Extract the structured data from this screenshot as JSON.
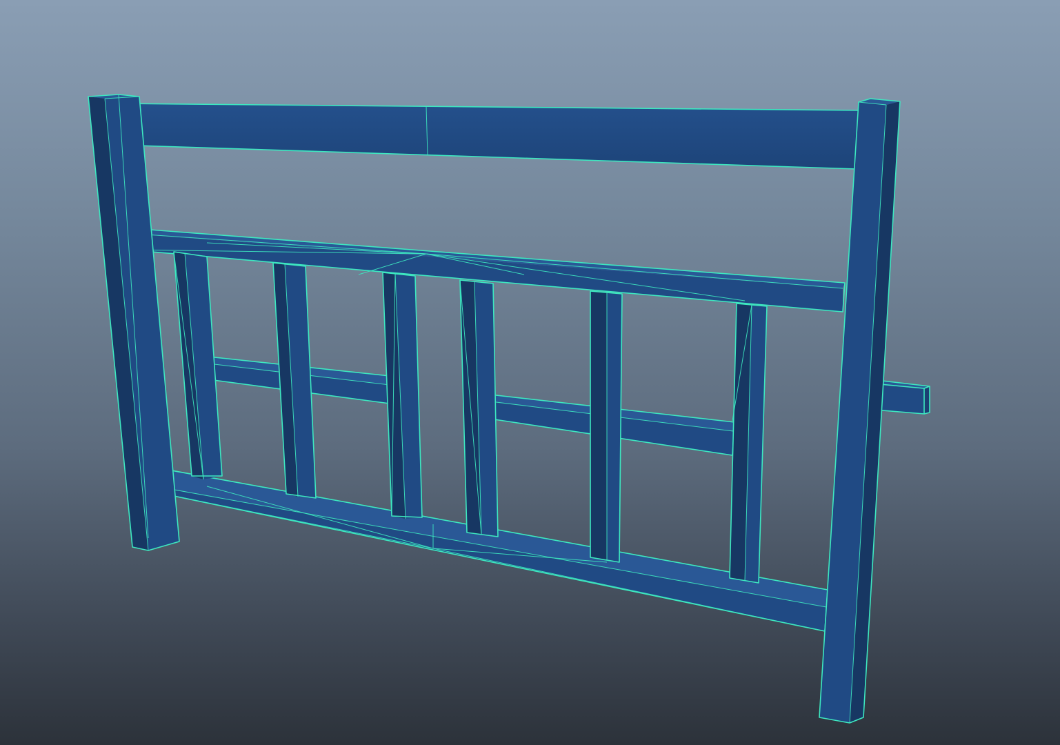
{
  "viewport": {
    "mode": "3d-perspective",
    "shading": "smooth-shade-with-wireframe",
    "background_gradient": [
      "#8a9eb4",
      "#2c323a"
    ]
  },
  "object": {
    "type": "fence-panel-mesh",
    "selected": true,
    "mesh_color": "#204a84",
    "wireframe_color": "#3de8c0"
  }
}
